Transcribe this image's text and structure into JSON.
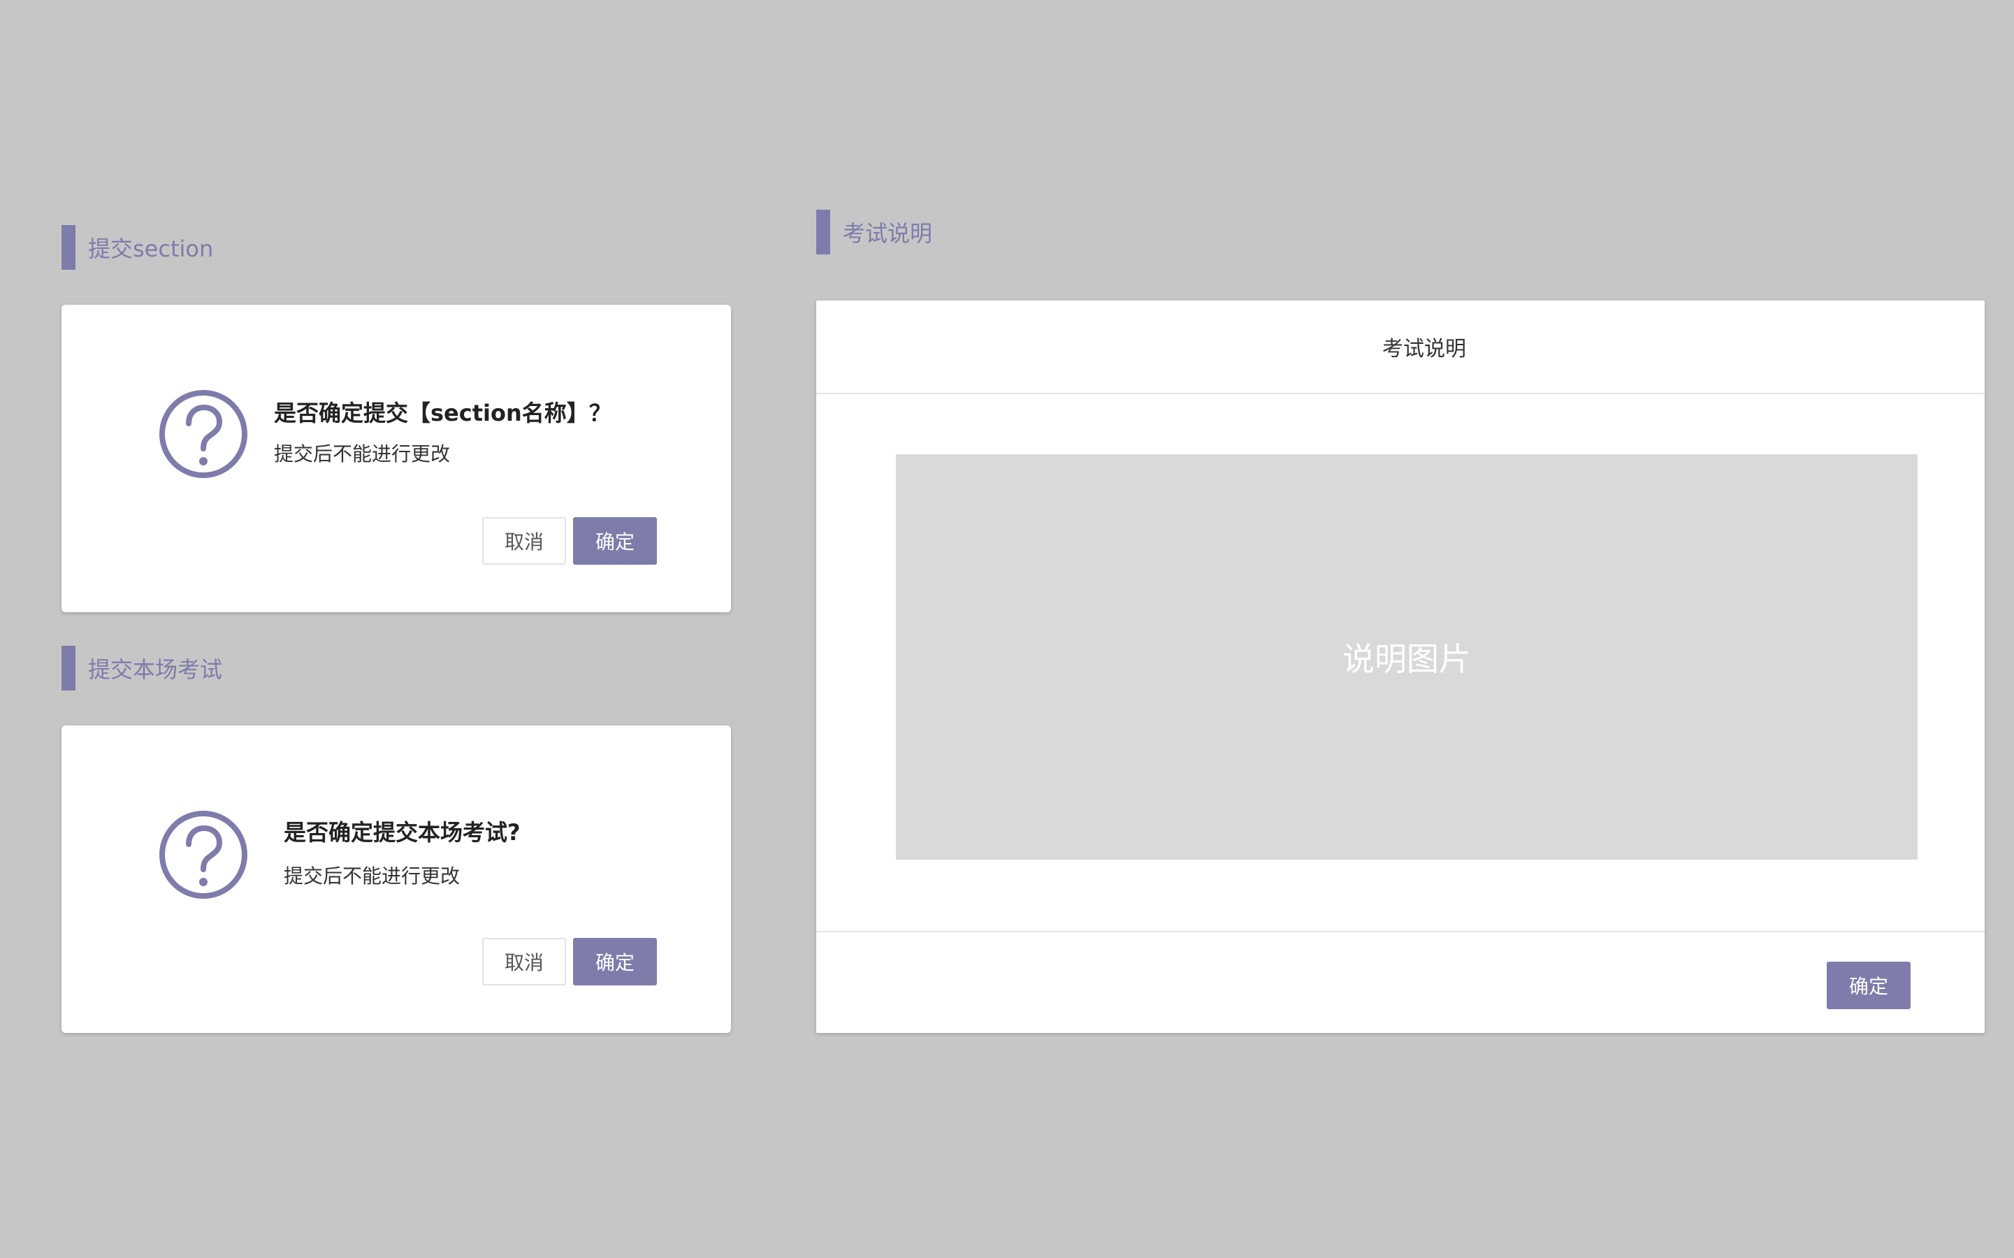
{
  "sections": {
    "submit_section": {
      "heading": "提交section",
      "dialog": {
        "title": "是否确定提交【section名称】？",
        "description": "提交后不能进行更改",
        "cancel_label": "取消",
        "ok_label": "确定",
        "icon": "question-circle-icon"
      }
    },
    "submit_exam": {
      "heading": "提交本场考试",
      "dialog": {
        "title": "是否确定提交本场考试?",
        "description": "提交后不能进行更改",
        "cancel_label": "取消",
        "ok_label": "确定",
        "icon": "question-circle-icon"
      }
    },
    "exam_instructions": {
      "heading": "考试说明",
      "dialog": {
        "title": "考试说明",
        "image_placeholder": "说明图片",
        "ok_label": "确定"
      }
    }
  },
  "colors": {
    "background": "#c6c6c6",
    "accent": "#7e7cab",
    "dialog_bg": "#ffffff",
    "image_placeholder_bg": "#d9d9d9"
  }
}
